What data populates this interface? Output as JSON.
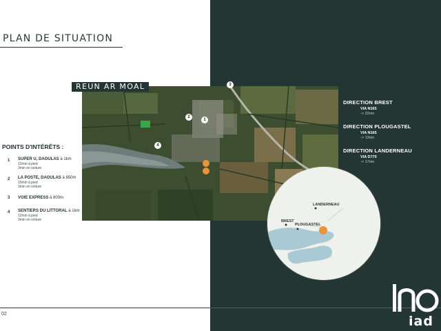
{
  "page": {
    "title": "PLAN DE SITUATION",
    "number": "02"
  },
  "map": {
    "location_label": "REUN AR MOAL",
    "markers": [
      "1",
      "2",
      "3",
      "4"
    ]
  },
  "points_of_interest": {
    "heading": "POINTS D'INTÉRÊTS :",
    "items": [
      {
        "num": "1",
        "name": "SUPER U, DAOULAS",
        "distance": "à 1km",
        "walk": "12min à pied",
        "drive": "3min en voiture"
      },
      {
        "num": "2",
        "name": "LA POSTE, DAOULAS",
        "distance": "à 850m",
        "walk": "10min à pied",
        "drive": "3min en voiture"
      },
      {
        "num": "3",
        "name": "VOIE EXPRESS",
        "distance": "à 800m",
        "walk": "",
        "drive": ""
      },
      {
        "num": "4",
        "name": "SENTIERS DU LITTORAL",
        "distance": "à 1km",
        "walk": "12min à pied",
        "drive": "3min en voiture"
      }
    ]
  },
  "directions": [
    {
      "title": "DIRECTION BREST",
      "via": "VIA N165",
      "time": "-> 22mn"
    },
    {
      "title": "DIRECTION PLOUGASTEL",
      "via": "VIA N165",
      "time": "-> 13mn"
    },
    {
      "title": "DIRECTION LANDERNEAU",
      "via": "VIA D770",
      "time": "-> 17mn"
    }
  ],
  "mini_map": {
    "labels": [
      "LANDERNEAU",
      "BREST",
      "PLOUGASTEL"
    ]
  },
  "logo": {
    "text": "iad"
  },
  "colors": {
    "dark_panel": "#233633",
    "marker_orange": "#e8943a",
    "water_blue": "#a9c9d4"
  }
}
